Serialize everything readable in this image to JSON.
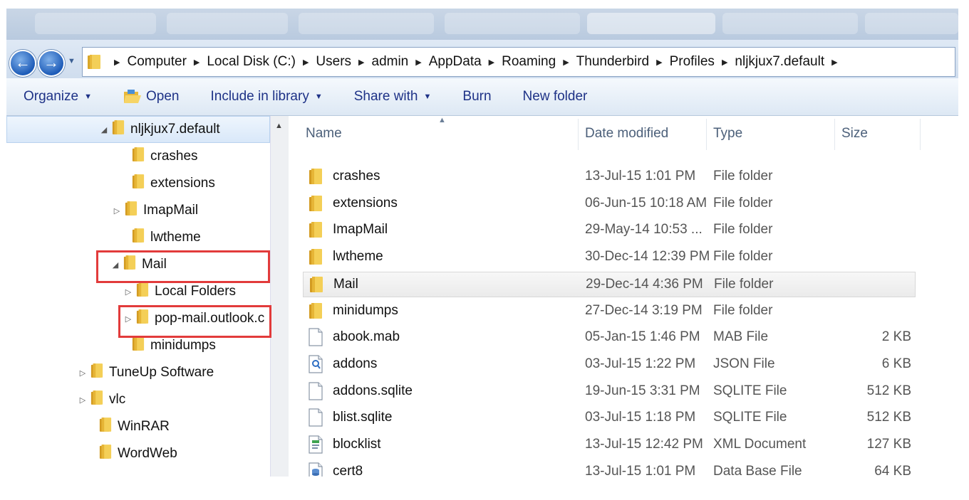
{
  "breadcrumbs": [
    "Computer",
    "Local Disk (C:)",
    "Users",
    "admin",
    "AppData",
    "Roaming",
    "Thunderbird",
    "Profiles",
    "nljkjux7.default"
  ],
  "toolbar": {
    "organize": "Organize",
    "open": "Open",
    "include": "Include in library",
    "share": "Share with",
    "burn": "Burn",
    "new_folder": "New folder"
  },
  "nav": {
    "items": [
      {
        "label": "nljkjux7.default",
        "expander": "◢"
      },
      {
        "label": "crashes",
        "expander": ""
      },
      {
        "label": "extensions",
        "expander": ""
      },
      {
        "label": "ImapMail",
        "expander": "▷"
      },
      {
        "label": "lwtheme",
        "expander": ""
      },
      {
        "label": "Mail",
        "expander": "◢"
      },
      {
        "label": "Local Folders",
        "expander": "▷"
      },
      {
        "label": "pop-mail.outlook.c",
        "expander": "▷"
      },
      {
        "label": "minidumps",
        "expander": ""
      },
      {
        "label": "TuneUp Software",
        "expander": "▷"
      },
      {
        "label": "vlc",
        "expander": "▷"
      },
      {
        "label": "WinRAR",
        "expander": ""
      },
      {
        "label": "WordWeb",
        "expander": ""
      }
    ]
  },
  "columns": {
    "name": "Name",
    "date": "Date modified",
    "type": "Type",
    "size": "Size"
  },
  "files": [
    {
      "name": "crashes",
      "date": "13-Jul-15 1:01 PM",
      "type": "File folder",
      "size": "",
      "icon": "folder-icon"
    },
    {
      "name": "extensions",
      "date": "06-Jun-15 10:18 AM",
      "type": "File folder",
      "size": "",
      "icon": "folder-icon"
    },
    {
      "name": "ImapMail",
      "date": "29-May-14 10:53 ...",
      "type": "File folder",
      "size": "",
      "icon": "folder-icon"
    },
    {
      "name": "lwtheme",
      "date": "30-Dec-14 12:39 PM",
      "type": "File folder",
      "size": "",
      "icon": "folder-icon"
    },
    {
      "name": "Mail",
      "date": "29-Dec-14 4:36 PM",
      "type": "File folder",
      "size": "",
      "icon": "folder-icon"
    },
    {
      "name": "minidumps",
      "date": "27-Dec-14 3:19 PM",
      "type": "File folder",
      "size": "",
      "icon": "folder-icon"
    },
    {
      "name": "abook.mab",
      "date": "05-Jan-15 1:46 PM",
      "type": "MAB File",
      "size": "2 KB",
      "icon": "file-icon"
    },
    {
      "name": "addons",
      "date": "03-Jul-15 1:22 PM",
      "type": "JSON File",
      "size": "6 KB",
      "icon": "json-file-icon"
    },
    {
      "name": "addons.sqlite",
      "date": "19-Jun-15 3:31 PM",
      "type": "SQLITE File",
      "size": "512 KB",
      "icon": "file-icon"
    },
    {
      "name": "blist.sqlite",
      "date": "03-Jul-15 1:18 PM",
      "type": "SQLITE File",
      "size": "512 KB",
      "icon": "file-icon"
    },
    {
      "name": "blocklist",
      "date": "13-Jul-15 12:42 PM",
      "type": "XML Document",
      "size": "127 KB",
      "icon": "xml-file-icon"
    },
    {
      "name": "cert8",
      "date": "13-Jul-15 1:01 PM",
      "type": "Data Base File",
      "size": "64 KB",
      "icon": "database-file-icon"
    }
  ],
  "colors": {
    "highlight_box": "#e23b3b",
    "link_text": "#1e3287"
  }
}
